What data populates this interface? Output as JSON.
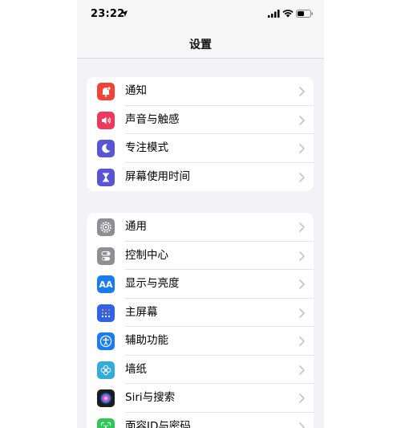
{
  "status": {
    "time": "23:22"
  },
  "nav": {
    "title": "设置"
  },
  "groups": [
    {
      "items": [
        {
          "label": "通知",
          "icon": "notification-icon",
          "color": "#f04438"
        },
        {
          "label": "声音与触感",
          "icon": "sound-icon",
          "color": "#f0385c"
        },
        {
          "label": "专注模式",
          "icon": "moon-icon",
          "color": "#5a54d6"
        },
        {
          "label": "屏幕使用时间",
          "icon": "hourglass-icon",
          "color": "#5a54d6"
        }
      ]
    },
    {
      "items": [
        {
          "label": "通用",
          "icon": "gear-icon",
          "color": "#8e8e93"
        },
        {
          "label": "控制中心",
          "icon": "toggle-icon",
          "color": "#8e8e93"
        },
        {
          "label": "显示与亮度",
          "icon": "text-size-icon",
          "color": "#1a7cf5",
          "glyph": "AA"
        },
        {
          "label": "主屏幕",
          "icon": "home-screen-icon",
          "color": "#2e62e8"
        },
        {
          "label": "辅助功能",
          "icon": "accessibility-icon",
          "color": "#1a7cf5"
        },
        {
          "label": "墙纸",
          "icon": "wallpaper-icon",
          "color": "#35aadc"
        },
        {
          "label": "Siri与搜索",
          "icon": "siri-icon",
          "color": "#1c1c1e"
        },
        {
          "label": "面容ID与密码",
          "icon": "face-id-icon",
          "color": "#30c758"
        }
      ]
    }
  ]
}
